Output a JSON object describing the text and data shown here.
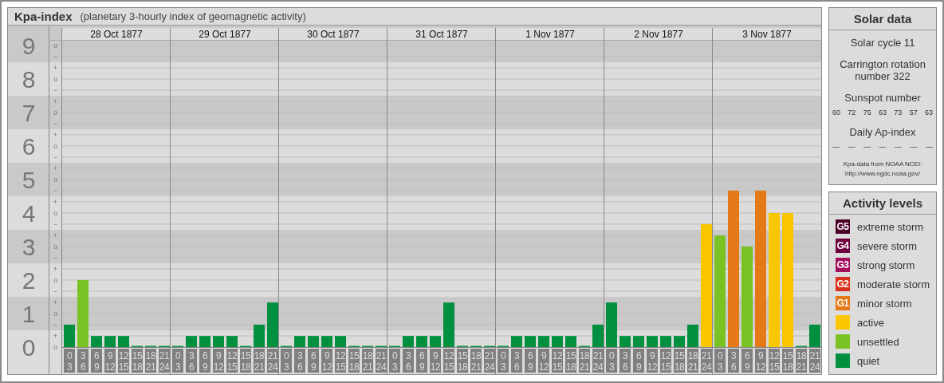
{
  "main_panel": {
    "title": "Kpa-index",
    "subtitle": "(planetary 3-hourly index of geomagnetic activity)"
  },
  "chart": {
    "days": [
      "28 Oct 1877",
      "29 Oct 1877",
      "30 Oct 1877",
      "31 Oct 1877",
      "1 Nov 1877",
      "2 Nov 1877",
      "3 Nov 1877"
    ],
    "subticks": [
      "o",
      "−",
      "+",
      "o",
      "−",
      "+",
      "o",
      "−",
      "+",
      "o",
      "−",
      "+",
      "o",
      "−",
      "+",
      "o",
      "−",
      "+",
      "o",
      "−",
      "+",
      "o",
      "−",
      "+",
      "o",
      "−",
      "+",
      "o"
    ],
    "chart_data": {
      "type": "bar",
      "stacked": true,
      "categories": [
        "0 3",
        "3 6",
        "6 9",
        "9 12",
        "12 15",
        "15 18",
        "18 21",
        "21 24",
        "0 3",
        "3 6",
        "6 9",
        "9 12",
        "12 15",
        "15 18",
        "18 21",
        "21 24",
        "0 3",
        "3 6",
        "6 9",
        "9 12",
        "12 15",
        "15 18",
        "18 21",
        "21 24",
        "0 3",
        "3 6",
        "6 9",
        "9 12",
        "12 15",
        "15 18",
        "18 21",
        "21 24",
        "0 3",
        "3 6",
        "6 9",
        "9 12",
        "12 15",
        "15 18",
        "18 21",
        "21 24",
        "0 3",
        "3 6",
        "6 9",
        "9 12",
        "12 15",
        "15 18",
        "18 21",
        "21 24",
        "0 3",
        "3 6",
        "6 9",
        "9 12",
        "12 15",
        "15 18",
        "18 21",
        "21 24"
      ],
      "ylim": [
        0,
        9
      ],
      "grid": true,
      "yticks": [
        {
          "value": 0,
          "label": "0"
        },
        {
          "value": 1,
          "label": "1"
        },
        {
          "value": 2,
          "label": "2"
        },
        {
          "value": 3,
          "label": "3"
        },
        {
          "value": 4,
          "label": "4"
        },
        {
          "value": 5,
          "label": "5"
        },
        {
          "value": 6,
          "label": "6"
        },
        {
          "value": 7,
          "label": "7"
        },
        {
          "value": 8,
          "label": "8"
        },
        {
          "value": 9,
          "label": "9"
        }
      ],
      "series": [
        {
          "color": "#009040",
          "values": [
            0.67,
            null,
            0.33,
            0.33,
            0.33,
            0,
            0,
            0,
            0,
            0.33,
            0.33,
            0.33,
            0.33,
            0,
            0.67,
            1.33,
            0,
            0.33,
            0.33,
            0.33,
            0.33,
            0,
            0,
            0,
            0,
            0.33,
            0.33,
            0.33,
            1.33,
            0,
            0,
            0,
            0,
            0.33,
            0.33,
            0.33,
            0.33,
            0.33,
            0,
            0.67,
            1.33,
            0.33,
            0.33,
            0.33,
            0.33,
            0.33,
            0.67,
            null,
            null,
            null,
            null,
            null,
            null,
            null,
            0,
            0.67
          ]
        },
        {
          "color": "#7ac223",
          "values": [
            null,
            2,
            null,
            null,
            null,
            null,
            null,
            null,
            null,
            null,
            null,
            null,
            null,
            null,
            null,
            null,
            null,
            null,
            null,
            null,
            null,
            null,
            null,
            null,
            null,
            null,
            null,
            null,
            null,
            null,
            null,
            null,
            null,
            null,
            null,
            null,
            null,
            null,
            null,
            null,
            null,
            null,
            null,
            null,
            null,
            null,
            null,
            null,
            3.33,
            null,
            3,
            null,
            null,
            null,
            null,
            null
          ]
        },
        {
          "color": "#f9c600",
          "values": [
            null,
            null,
            null,
            null,
            null,
            null,
            null,
            null,
            null,
            null,
            null,
            null,
            null,
            null,
            null,
            null,
            null,
            null,
            null,
            null,
            null,
            null,
            null,
            null,
            null,
            null,
            null,
            null,
            null,
            null,
            null,
            null,
            null,
            null,
            null,
            null,
            null,
            null,
            null,
            null,
            null,
            null,
            null,
            null,
            null,
            null,
            null,
            3.67,
            null,
            null,
            null,
            null,
            4,
            4,
            null,
            null
          ]
        },
        {
          "color": "#e57817",
          "values": [
            null,
            null,
            null,
            null,
            null,
            null,
            null,
            null,
            null,
            null,
            null,
            null,
            null,
            null,
            null,
            null,
            null,
            null,
            null,
            null,
            null,
            null,
            null,
            null,
            null,
            null,
            null,
            null,
            null,
            null,
            null,
            null,
            null,
            null,
            null,
            null,
            null,
            null,
            null,
            null,
            null,
            null,
            null,
            null,
            null,
            null,
            null,
            null,
            null,
            4.67,
            null,
            4.67,
            null,
            null,
            null,
            null
          ]
        }
      ]
    }
  },
  "solar_data": {
    "title": "Solar data",
    "solar_cycle": "Solar cycle 11",
    "carrington": "Carrington rotation number 322",
    "sunspot_title": "Sunspot number",
    "sunspots": [
      "60",
      "72",
      "75",
      "63",
      "73",
      "57",
      "63"
    ],
    "ap_title": "Daily Ap-index",
    "ap_values": [
      "—",
      "—",
      "—",
      "—",
      "—",
      "—",
      "—"
    ],
    "source": "Kpa-data from NOAA NCEI:",
    "source_url": "http://www.ngdc.noaa.gov/"
  },
  "legend": {
    "title": "Activity levels",
    "items": [
      {
        "code": "G5",
        "label": "extreme storm",
        "color": "#4a0026"
      },
      {
        "code": "G4",
        "label": "severe storm",
        "color": "#6e0040"
      },
      {
        "code": "G3",
        "label": "strong storm",
        "color": "#a30f5c"
      },
      {
        "code": "G2",
        "label": "moderate storm",
        "color": "#d8301c"
      },
      {
        "code": "G1",
        "label": "minor storm",
        "color": "#e57817"
      },
      {
        "label": "active",
        "color": "#f9c600"
      },
      {
        "label": "unsettled",
        "color": "#7ac223"
      },
      {
        "label": "quiet",
        "color": "#009040"
      }
    ]
  }
}
